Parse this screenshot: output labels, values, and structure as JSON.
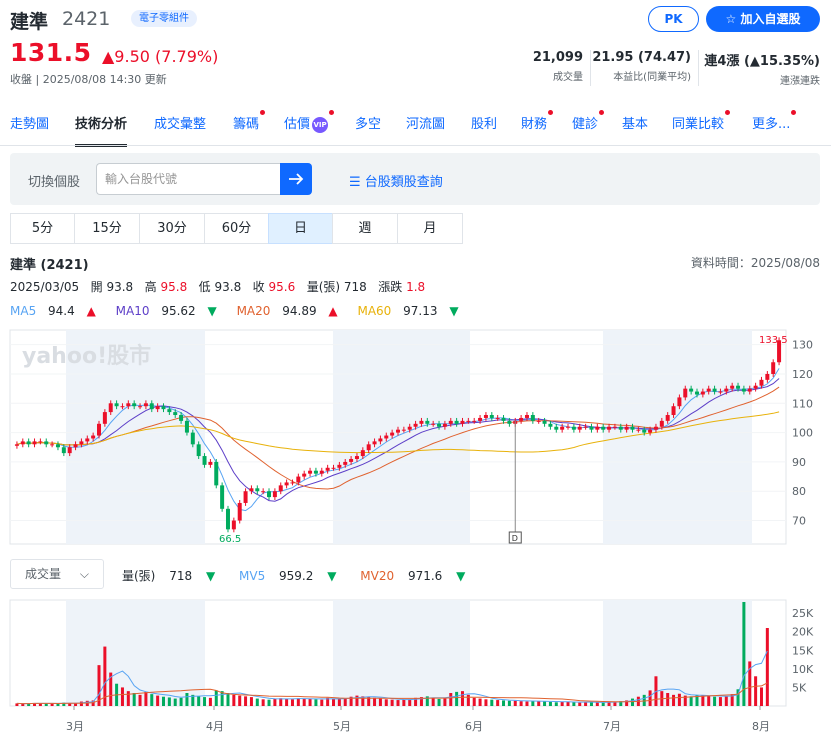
{
  "header": {
    "name": "建準",
    "code": "2421",
    "category": "電子零組件",
    "price": "131.5",
    "change": "▲9.50 (7.79%)",
    "timestamp": "收盤 | 2025/08/08 14:30 更新",
    "pk_label": "PK",
    "watch_label": "加入自選股",
    "stats": [
      {
        "value": "21,099",
        "label": "成交量"
      },
      {
        "value": "21.95 (74.47)",
        "label": "本益比(同業平均)"
      },
      {
        "value": "連4漲 (▲15.35%)",
        "label": "連漲連跌"
      }
    ]
  },
  "nav": {
    "tabs": [
      "走勢圖",
      "技術分析",
      "成交彙整",
      "籌碼",
      "估價",
      "多空",
      "河流圖",
      "股利",
      "財務",
      "健診",
      "基本",
      "同業比較",
      "更多..."
    ],
    "vip": "VIP"
  },
  "switcher": {
    "label": "切換個股",
    "placeholder": "輸入台股代號",
    "category_link": "台股類股查詢"
  },
  "periods": [
    "5分",
    "15分",
    "30分",
    "60分",
    "日",
    "週",
    "月"
  ],
  "info": {
    "stock": "建準 (2421)",
    "data_time": "資料時間：2025/08/08",
    "date": "2025/03/05",
    "open_label": "開",
    "open": "93.8",
    "high_label": "高",
    "high": "95.8",
    "low_label": "低",
    "low": "93.8",
    "close_label": "收",
    "close": "95.6",
    "vol_label": "量(張)",
    "vol": "718",
    "chg_label": "漲跌",
    "chg": "1.8"
  },
  "ma": [
    {
      "label": "MA5",
      "value": "94.4",
      "dir": "▲",
      "color": "#58a4f3"
    },
    {
      "label": "MA10",
      "value": "95.62",
      "dir": "▼",
      "color": "#5d3fc8"
    },
    {
      "label": "MA20",
      "value": "94.89",
      "dir": "▲",
      "color": "#e0622f"
    },
    {
      "label": "MA60",
      "value": "97.13",
      "dir": "▼",
      "color": "#e8b20b"
    }
  ],
  "watermark": "yahoo!股市",
  "chart_data": {
    "type": "candlestick",
    "y_ticks": [
      "130",
      "120",
      "110",
      "100",
      "90",
      "80",
      "70"
    ],
    "ylim": [
      62,
      135
    ],
    "x_ticks": [
      "3月",
      "4月",
      "5月",
      "6月",
      "7月",
      "8月"
    ],
    "max_label": "133.5",
    "min_label": "66.5",
    "marker": "D",
    "closes": [
      96,
      97,
      96,
      97,
      97,
      96,
      96,
      95,
      93,
      95,
      96,
      97,
      98,
      99,
      103,
      107,
      110,
      109,
      109,
      110,
      109,
      109,
      110,
      108,
      109,
      108,
      107,
      106,
      104,
      100,
      96,
      92,
      89,
      90,
      82,
      74,
      67,
      70,
      76,
      80,
      81,
      80,
      80,
      78,
      80,
      82,
      83,
      83,
      85,
      86,
      87,
      86,
      87,
      88,
      88,
      89,
      90,
      91,
      92,
      94,
      96,
      97,
      98,
      99,
      100,
      101,
      101,
      102,
      103,
      104,
      103,
      103,
      102,
      103,
      104,
      103,
      104,
      104,
      104,
      105,
      106,
      105,
      105,
      104,
      103,
      104,
      105,
      106,
      104,
      104,
      103,
      102,
      101,
      102,
      102,
      101,
      102,
      102,
      101,
      102,
      101,
      102,
      102,
      101,
      102,
      101,
      101,
      100,
      101,
      102,
      104,
      106,
      109,
      112,
      115,
      114,
      113,
      114,
      115,
      114,
      114,
      115,
      116,
      115,
      114,
      115,
      116,
      118,
      120,
      124,
      131.5
    ],
    "volume_series": [
      {
        "name": "量(張)"
      }
    ],
    "volumes": [
      700,
      600,
      650,
      800,
      750,
      700,
      650,
      600,
      900,
      800,
      700,
      1200,
      1400,
      1500,
      11000,
      16000,
      9000,
      6000,
      5000,
      4000,
      3500,
      3000,
      3800,
      3200,
      2800,
      2500,
      2300,
      2000,
      2200,
      3500,
      3000,
      2600,
      2400,
      2200,
      4200,
      4000,
      3500,
      3000,
      2800,
      2600,
      2400,
      2000,
      1800,
      1700,
      1900,
      2100,
      2000,
      1800,
      2100,
      1900,
      2000,
      1800,
      1700,
      2200,
      2000,
      1900,
      2100,
      2500,
      2800,
      2600,
      2400,
      2200,
      2000,
      1800,
      1700,
      1600,
      1700,
      1800,
      2200,
      2400,
      2600,
      2100,
      1900,
      2000,
      3500,
      3800,
      4000,
      3000,
      2200,
      2000,
      1800,
      1700,
      1600,
      1500,
      1400,
      1400,
      1300,
      1200,
      1400,
      1300,
      1200,
      1100,
      1000,
      1100,
      1200,
      1000,
      900,
      1000,
      1100,
      1000,
      900,
      1100,
      1200,
      1300,
      1500,
      2000,
      2500,
      3000,
      4200,
      8000,
      4000,
      3500,
      3000,
      3300,
      2800,
      2600,
      3000,
      2900,
      2700,
      2500,
      2400,
      2600,
      3200,
      4500,
      28000,
      12000,
      8000,
      5000,
      21000
    ],
    "vol_ticks": [
      "25K",
      "20K",
      "15K",
      "10K",
      "5K"
    ],
    "vol_max": 28000
  },
  "volume": {
    "selector": "成交量",
    "legend": [
      {
        "label": "量(張)",
        "value": "718",
        "dir": "▼",
        "color": "#232a31"
      },
      {
        "label": "MV5",
        "value": "959.2",
        "dir": "▼",
        "color": "#58a4f3"
      },
      {
        "label": "MV20",
        "value": "971.6",
        "dir": "▼",
        "color": "#e0622f"
      }
    ]
  },
  "colors": {
    "up": "#eb0f29",
    "down": "#00ab5e",
    "accent": "#0f69ff"
  }
}
